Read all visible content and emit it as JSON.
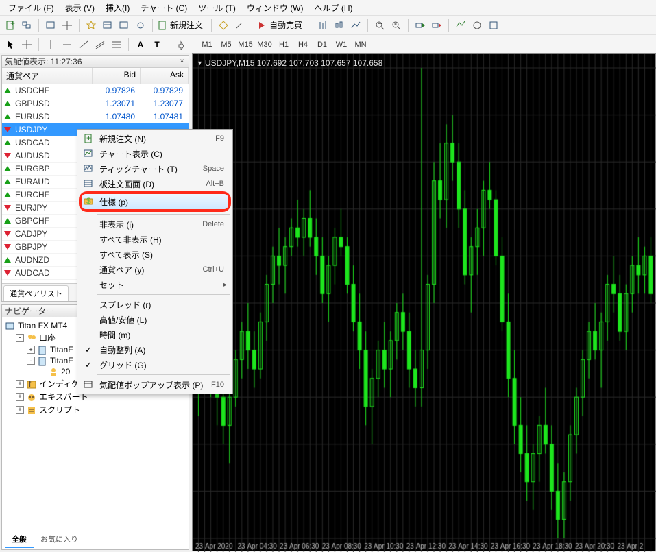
{
  "menu": [
    "ファイル (F)",
    "表示 (V)",
    "挿入(I)",
    "チャート (C)",
    "ツール (T)",
    "ウィンドウ (W)",
    "ヘルプ (H)"
  ],
  "toolbar2_labels": {
    "new_order": "新規注文",
    "ea": "自動売買"
  },
  "timeframes": [
    "M1",
    "M5",
    "M15",
    "M30",
    "H1",
    "H4",
    "D1",
    "W1",
    "MN"
  ],
  "market_watch": {
    "title": "気配値表示: 11:27:36",
    "headers": {
      "symbol": "通貨ペア",
      "bid": "Bid",
      "ask": "Ask"
    },
    "rows": [
      {
        "sym": "USDCHF",
        "bid": "0.97826",
        "ask": "0.97829",
        "dir": "up"
      },
      {
        "sym": "GBPUSD",
        "bid": "1.23071",
        "ask": "1.23077",
        "dir": "up"
      },
      {
        "sym": "EURUSD",
        "bid": "1.07480",
        "ask": "1.07481",
        "dir": "up"
      },
      {
        "sym": "USDJPY",
        "bid": "",
        "ask": "",
        "dir": "dn",
        "selected": true
      },
      {
        "sym": "USDCAD",
        "bid": "",
        "ask": "",
        "dir": "up"
      },
      {
        "sym": "AUDUSD",
        "bid": "",
        "ask": "",
        "dir": "dn"
      },
      {
        "sym": "EURGBP",
        "bid": "",
        "ask": "",
        "dir": "up"
      },
      {
        "sym": "EURAUD",
        "bid": "",
        "ask": "",
        "dir": "up"
      },
      {
        "sym": "EURCHF",
        "bid": "",
        "ask": "",
        "dir": "up"
      },
      {
        "sym": "EURJPY",
        "bid": "",
        "ask": "",
        "dir": "dn"
      },
      {
        "sym": "GBPCHF",
        "bid": "",
        "ask": "",
        "dir": "up"
      },
      {
        "sym": "CADJPY",
        "bid": "",
        "ask": "",
        "dir": "dn"
      },
      {
        "sym": "GBPJPY",
        "bid": "",
        "ask": "",
        "dir": "dn"
      },
      {
        "sym": "AUDNZD",
        "bid": "",
        "ask": "",
        "dir": "up"
      },
      {
        "sym": "AUDCAD",
        "bid": "",
        "ask": "",
        "dir": "dn"
      }
    ],
    "tab": "通貨ペアリスト"
  },
  "navigator": {
    "title": "ナビゲーター",
    "root": "Titan FX MT4",
    "nodes": [
      {
        "label": "口座",
        "indent": 1,
        "exp": "-",
        "icon": "people"
      },
      {
        "label": "TitanF",
        "indent": 2,
        "exp": "+",
        "icon": "doc"
      },
      {
        "label": "TitanF",
        "indent": 2,
        "exp": "-",
        "icon": "doc"
      },
      {
        "label": "20",
        "indent": 3,
        "exp": "",
        "icon": "user"
      },
      {
        "label": "インディケー",
        "indent": 1,
        "exp": "+",
        "icon": "fx"
      },
      {
        "label": "エキスパート",
        "indent": 1,
        "exp": "+",
        "icon": "ea"
      },
      {
        "label": "スクリプト",
        "indent": 1,
        "exp": "+",
        "icon": "scr"
      }
    ],
    "tabs": {
      "general": "全般",
      "fav": "お気に入り"
    }
  },
  "chart": {
    "caption": "USDJPY,M15  107.692 107.703 107.657 107.658",
    "time_axis": [
      "23 Apr 2020",
      "23 Apr 04:30",
      "23 Apr 06:30",
      "23 Apr 08:30",
      "23 Apr 10:30",
      "23 Apr 12:30",
      "23 Apr 14:30",
      "23 Apr 16:30",
      "23 Apr 18:30",
      "23 Apr 20:30",
      "23 Apr 2"
    ]
  },
  "context_menu": {
    "items": [
      {
        "label": "新規注文 (N)",
        "acc": "F9",
        "icon": "order"
      },
      {
        "label": "チャート表示 (C)",
        "icon": "chart"
      },
      {
        "label": "ティックチャート (T)",
        "acc": "Space",
        "icon": "tick"
      },
      {
        "label": "板注文画面 (D)",
        "acc": "Alt+B",
        "icon": "depth"
      },
      {
        "label": "仕様 (p)",
        "icon": "spec",
        "highlight": true
      },
      {
        "sep": true
      },
      {
        "label": "非表示 (i)",
        "acc": "Delete"
      },
      {
        "label": "すべて非表示 (H)"
      },
      {
        "label": "すべて表示 (S)"
      },
      {
        "label": "通貨ペア (y)",
        "acc": "Ctrl+U"
      },
      {
        "label": "セット",
        "sub": true
      },
      {
        "sep": true
      },
      {
        "label": "スプレッド (r)"
      },
      {
        "label": "高値/安値 (L)"
      },
      {
        "label": "時間 (m)"
      },
      {
        "label": "自動整列 (A)",
        "check": true
      },
      {
        "label": "グリッド (G)",
        "check": true
      },
      {
        "sep": true
      },
      {
        "label": "気配値ポップアップ表示 (P)",
        "acc": "F10",
        "icon": "popup"
      }
    ]
  },
  "chart_data": {
    "type": "candlestick",
    "symbol": "USDJPY",
    "timeframe": "M15",
    "title": "USDJPY,M15",
    "ohlc_last": {
      "open": 107.692,
      "high": 107.703,
      "low": 107.657,
      "close": 107.658
    },
    "ylim": [
      107.4,
      107.9
    ],
    "xlabel": "23 Apr 2020",
    "x_ticks": [
      "04:30",
      "06:30",
      "08:30",
      "10:30",
      "12:30",
      "14:30",
      "16:30",
      "18:30",
      "20:30"
    ],
    "series": [
      {
        "name": "USDJPY M15",
        "note": "approximate OHLC values estimated from chart pixels",
        "candles": [
          {
            "t": "02:30",
            "o": 107.56,
            "h": 107.6,
            "l": 107.53,
            "c": 107.58
          },
          {
            "t": "02:45",
            "o": 107.58,
            "h": 107.61,
            "l": 107.56,
            "c": 107.6
          },
          {
            "t": "03:00",
            "o": 107.6,
            "h": 107.63,
            "l": 107.55,
            "c": 107.57
          },
          {
            "t": "03:15",
            "o": 107.57,
            "h": 107.59,
            "l": 107.52,
            "c": 107.55
          },
          {
            "t": "03:30",
            "o": 107.55,
            "h": 107.58,
            "l": 107.5,
            "c": 107.52
          },
          {
            "t": "03:45",
            "o": 107.52,
            "h": 107.56,
            "l": 107.48,
            "c": 107.55
          },
          {
            "t": "04:00",
            "o": 107.55,
            "h": 107.6,
            "l": 107.54,
            "c": 107.59
          },
          {
            "t": "04:15",
            "o": 107.59,
            "h": 107.63,
            "l": 107.57,
            "c": 107.62
          },
          {
            "t": "04:30",
            "o": 107.62,
            "h": 107.65,
            "l": 107.58,
            "c": 107.6
          },
          {
            "t": "04:45",
            "o": 107.6,
            "h": 107.62,
            "l": 107.56,
            "c": 107.58
          },
          {
            "t": "05:00",
            "o": 107.58,
            "h": 107.64,
            "l": 107.57,
            "c": 107.63
          },
          {
            "t": "05:15",
            "o": 107.63,
            "h": 107.68,
            "l": 107.61,
            "c": 107.67
          },
          {
            "t": "05:30",
            "o": 107.67,
            "h": 107.71,
            "l": 107.65,
            "c": 107.7
          },
          {
            "t": "05:45",
            "o": 107.7,
            "h": 107.73,
            "l": 107.67,
            "c": 107.69
          },
          {
            "t": "06:00",
            "o": 107.69,
            "h": 107.72,
            "l": 107.66,
            "c": 107.71
          },
          {
            "t": "06:15",
            "o": 107.71,
            "h": 107.74,
            "l": 107.7,
            "c": 107.73
          },
          {
            "t": "06:30",
            "o": 107.73,
            "h": 107.76,
            "l": 107.71,
            "c": 107.72
          },
          {
            "t": "06:45",
            "o": 107.72,
            "h": 107.75,
            "l": 107.7,
            "c": 107.74
          },
          {
            "t": "07:00",
            "o": 107.74,
            "h": 107.77,
            "l": 107.71,
            "c": 107.72
          },
          {
            "t": "07:15",
            "o": 107.72,
            "h": 107.74,
            "l": 107.68,
            "c": 107.7
          },
          {
            "t": "07:30",
            "o": 107.7,
            "h": 107.72,
            "l": 107.65,
            "c": 107.66
          },
          {
            "t": "07:45",
            "o": 107.66,
            "h": 107.7,
            "l": 107.63,
            "c": 107.69
          },
          {
            "t": "08:00",
            "o": 107.69,
            "h": 107.73,
            "l": 107.67,
            "c": 107.72
          },
          {
            "t": "08:15",
            "o": 107.72,
            "h": 107.75,
            "l": 107.7,
            "c": 107.71
          },
          {
            "t": "08:30",
            "o": 107.71,
            "h": 107.72,
            "l": 107.66,
            "c": 107.67
          },
          {
            "t": "08:45",
            "o": 107.67,
            "h": 107.69,
            "l": 107.62,
            "c": 107.63
          },
          {
            "t": "09:00",
            "o": 107.63,
            "h": 107.66,
            "l": 107.58,
            "c": 107.6
          },
          {
            "t": "09:15",
            "o": 107.6,
            "h": 107.62,
            "l": 107.52,
            "c": 107.54
          },
          {
            "t": "09:30",
            "o": 107.54,
            "h": 107.58,
            "l": 107.5,
            "c": 107.57
          },
          {
            "t": "09:45",
            "o": 107.57,
            "h": 107.61,
            "l": 107.55,
            "c": 107.6
          },
          {
            "t": "10:00",
            "o": 107.6,
            "h": 107.63,
            "l": 107.56,
            "c": 107.58
          },
          {
            "t": "10:15",
            "o": 107.58,
            "h": 107.62,
            "l": 107.55,
            "c": 107.61
          },
          {
            "t": "10:30",
            "o": 107.61,
            "h": 107.65,
            "l": 107.59,
            "c": 107.64
          },
          {
            "t": "10:45",
            "o": 107.64,
            "h": 107.66,
            "l": 107.6,
            "c": 107.62
          },
          {
            "t": "11:00",
            "o": 107.62,
            "h": 107.64,
            "l": 107.56,
            "c": 107.58
          },
          {
            "t": "11:15",
            "o": 107.58,
            "h": 107.6,
            "l": 107.54,
            "c": 107.56
          },
          {
            "t": "11:30",
            "o": 107.56,
            "h": 107.9,
            "l": 107.54,
            "c": 107.6
          },
          {
            "t": "11:45",
            "o": 107.6,
            "h": 107.68,
            "l": 107.58,
            "c": 107.67
          },
          {
            "t": "12:00",
            "o": 107.67,
            "h": 107.8,
            "l": 107.65,
            "c": 107.78
          },
          {
            "t": "12:15",
            "o": 107.78,
            "h": 107.82,
            "l": 107.74,
            "c": 107.76
          },
          {
            "t": "12:30",
            "o": 107.76,
            "h": 107.84,
            "l": 107.73,
            "c": 107.82
          },
          {
            "t": "12:45",
            "o": 107.82,
            "h": 107.85,
            "l": 107.78,
            "c": 107.8
          },
          {
            "t": "13:00",
            "o": 107.8,
            "h": 107.82,
            "l": 107.73,
            "c": 107.75
          },
          {
            "t": "13:15",
            "o": 107.75,
            "h": 107.77,
            "l": 107.67,
            "c": 107.68
          },
          {
            "t": "13:30",
            "o": 107.68,
            "h": 107.72,
            "l": 107.64,
            "c": 107.71
          },
          {
            "t": "13:45",
            "o": 107.71,
            "h": 107.75,
            "l": 107.68,
            "c": 107.73
          },
          {
            "t": "14:00",
            "o": 107.73,
            "h": 107.78,
            "l": 107.7,
            "c": 107.77
          },
          {
            "t": "14:15",
            "o": 107.77,
            "h": 107.8,
            "l": 107.75,
            "c": 107.76
          },
          {
            "t": "14:30",
            "o": 107.76,
            "h": 107.77,
            "l": 107.69,
            "c": 107.7
          },
          {
            "t": "14:45",
            "o": 107.7,
            "h": 107.72,
            "l": 107.62,
            "c": 107.63
          },
          {
            "t": "15:00",
            "o": 107.63,
            "h": 107.66,
            "l": 107.55,
            "c": 107.57
          },
          {
            "t": "15:15",
            "o": 107.57,
            "h": 107.6,
            "l": 107.5,
            "c": 107.52
          },
          {
            "t": "15:30",
            "o": 107.52,
            "h": 107.55,
            "l": 107.47,
            "c": 107.49
          },
          {
            "t": "15:45",
            "o": 107.49,
            "h": 107.52,
            "l": 107.44,
            "c": 107.46
          },
          {
            "t": "16:00",
            "o": 107.46,
            "h": 107.5,
            "l": 107.43,
            "c": 107.49
          },
          {
            "t": "16:15",
            "o": 107.49,
            "h": 107.53,
            "l": 107.46,
            "c": 107.52
          },
          {
            "t": "16:30",
            "o": 107.52,
            "h": 107.56,
            "l": 107.49,
            "c": 107.5
          },
          {
            "t": "16:45",
            "o": 107.5,
            "h": 107.52,
            "l": 107.43,
            "c": 107.45
          },
          {
            "t": "17:00",
            "o": 107.45,
            "h": 107.48,
            "l": 107.4,
            "c": 107.42
          },
          {
            "t": "17:15",
            "o": 107.42,
            "h": 107.47,
            "l": 107.4,
            "c": 107.46
          },
          {
            "t": "17:30",
            "o": 107.46,
            "h": 107.52,
            "l": 107.44,
            "c": 107.51
          },
          {
            "t": "17:45",
            "o": 107.51,
            "h": 107.56,
            "l": 107.49,
            "c": 107.55
          },
          {
            "t": "18:00",
            "o": 107.55,
            "h": 107.6,
            "l": 107.53,
            "c": 107.59
          },
          {
            "t": "18:15",
            "o": 107.59,
            "h": 107.63,
            "l": 107.57,
            "c": 107.62
          },
          {
            "t": "18:30",
            "o": 107.62,
            "h": 107.65,
            "l": 107.59,
            "c": 107.6
          },
          {
            "t": "18:45",
            "o": 107.6,
            "h": 107.64,
            "l": 107.56,
            "c": 107.63
          },
          {
            "t": "19:00",
            "o": 107.63,
            "h": 107.68,
            "l": 107.61,
            "c": 107.67
          },
          {
            "t": "19:15",
            "o": 107.67,
            "h": 107.7,
            "l": 107.64,
            "c": 107.66
          },
          {
            "t": "19:30",
            "o": 107.66,
            "h": 107.68,
            "l": 107.61,
            "c": 107.62
          },
          {
            "t": "19:45",
            "o": 107.62,
            "h": 107.67,
            "l": 107.6,
            "c": 107.66
          },
          {
            "t": "20:00",
            "o": 107.66,
            "h": 107.7,
            "l": 107.64,
            "c": 107.69
          },
          {
            "t": "20:15",
            "o": 107.69,
            "h": 107.72,
            "l": 107.66,
            "c": 107.68
          },
          {
            "t": "20:30",
            "o": 107.68,
            "h": 107.71,
            "l": 107.66,
            "c": 107.7
          },
          {
            "t": "20:45",
            "o": 107.7,
            "h": 107.72,
            "l": 107.65,
            "c": 107.66
          }
        ]
      }
    ]
  }
}
